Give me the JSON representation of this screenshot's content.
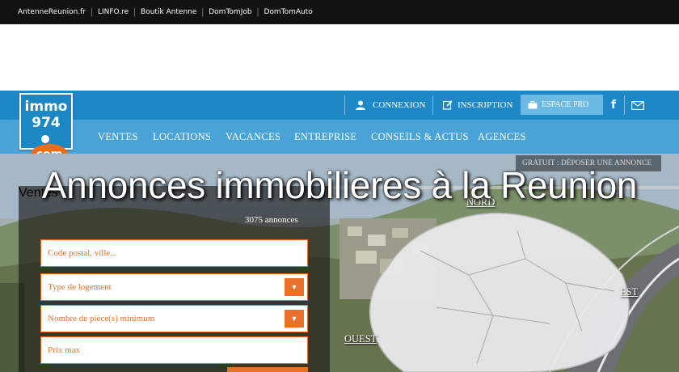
{
  "network_bar": {
    "links": [
      "AntenneReunion.fr",
      "LINFO.re",
      "Boutik Antenne",
      "DomTomJob",
      "DomTomAuto"
    ]
  },
  "logo": {
    "line1": "immo",
    "line2": "974",
    "suffix": "com"
  },
  "user_bar": {
    "connexion": "CONNEXION",
    "inscription": "INSCRIPTION",
    "espace_pro": "ESPACE PRO",
    "facebook": "f"
  },
  "menu": {
    "items": [
      "VENTES",
      "LOCATIONS",
      "VACANCES",
      "ENTREPRISE",
      "CONSEILS & ACTUS",
      "AGENCES"
    ]
  },
  "hero": {
    "headline": "Annonces immobilieres à la Reunion",
    "gratuit": "GRATUIT : DÉPOSER UNE ANNONCE"
  },
  "search": {
    "tab_label": "Ventes",
    "count": "3075 annonces",
    "location_placeholder": "Code postal, ville...",
    "type_placeholder": "Type de logement",
    "rooms_placeholder": "Nombre de pièce(s) minimum",
    "price_placeholder": "Prix max"
  },
  "map": {
    "nord": "NORD",
    "est": "EST",
    "ouest": "OUEST"
  },
  "colors": {
    "brand_blue": "#1e87c6",
    "menu_blue": "#4aa3d6",
    "accent_orange": "#e8702a"
  }
}
